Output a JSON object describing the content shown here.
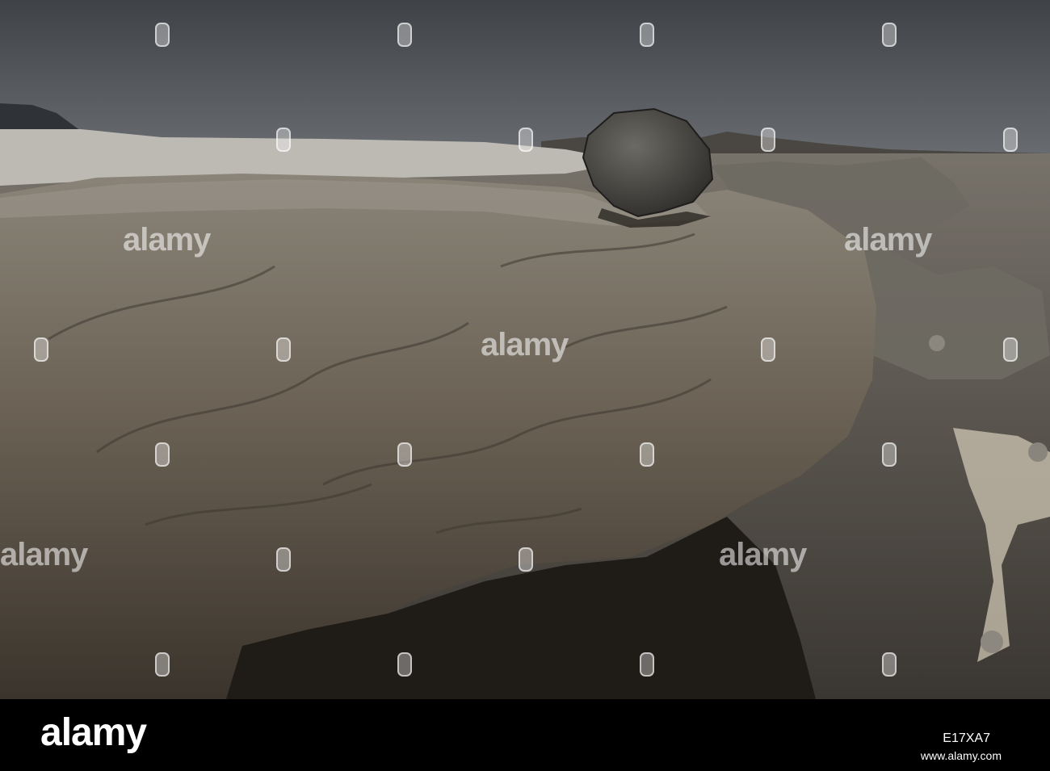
{
  "watermark": {
    "text": "alamy"
  },
  "footer": {
    "logo": "alamy",
    "image_id": "E17XA7",
    "url": "www.alamy.com"
  },
  "colors": {
    "sky": "#4a4d52",
    "rock": "#6b6255",
    "ground": "#5b564e",
    "footer_bg": "#000000"
  }
}
